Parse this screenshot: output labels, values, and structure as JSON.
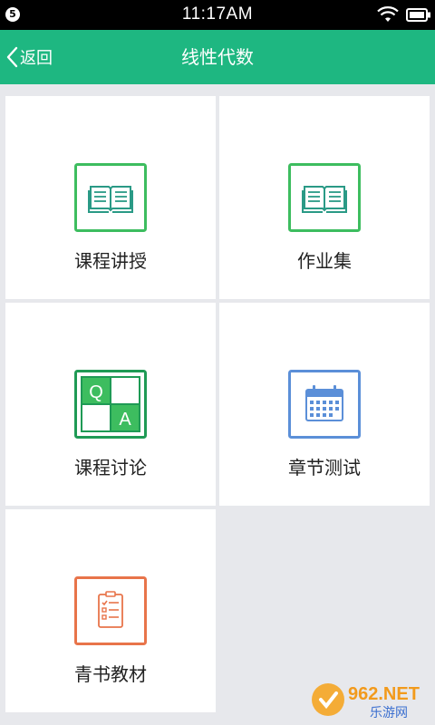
{
  "status_bar": {
    "badge": "5",
    "time": "11:17AM",
    "icons": [
      "wifi-icon",
      "battery-icon"
    ]
  },
  "header": {
    "back_label": "返回",
    "title": "线性代数"
  },
  "tiles": [
    {
      "label": "课程讲授",
      "icon": "open-book-icon",
      "color": "#3dbd5f"
    },
    {
      "label": "作业集",
      "icon": "open-book-icon",
      "color": "#3dbd5f"
    },
    {
      "label": "课程讨论",
      "icon": "qa-icon",
      "color": "#1f9a55"
    },
    {
      "label": "章节测试",
      "icon": "calendar-icon",
      "color": "#5b8fd8"
    },
    {
      "label": "青书教材",
      "icon": "clipboard-icon",
      "color": "#e8744a"
    }
  ],
  "qa_icon": {
    "q": "Q",
    "a": "A"
  },
  "watermark": {
    "brand": "962.NET",
    "subtitle": "乐游网"
  },
  "colors": {
    "header": "#1eb781",
    "background": "#e7e8ec",
    "tile": "#ffffff"
  }
}
